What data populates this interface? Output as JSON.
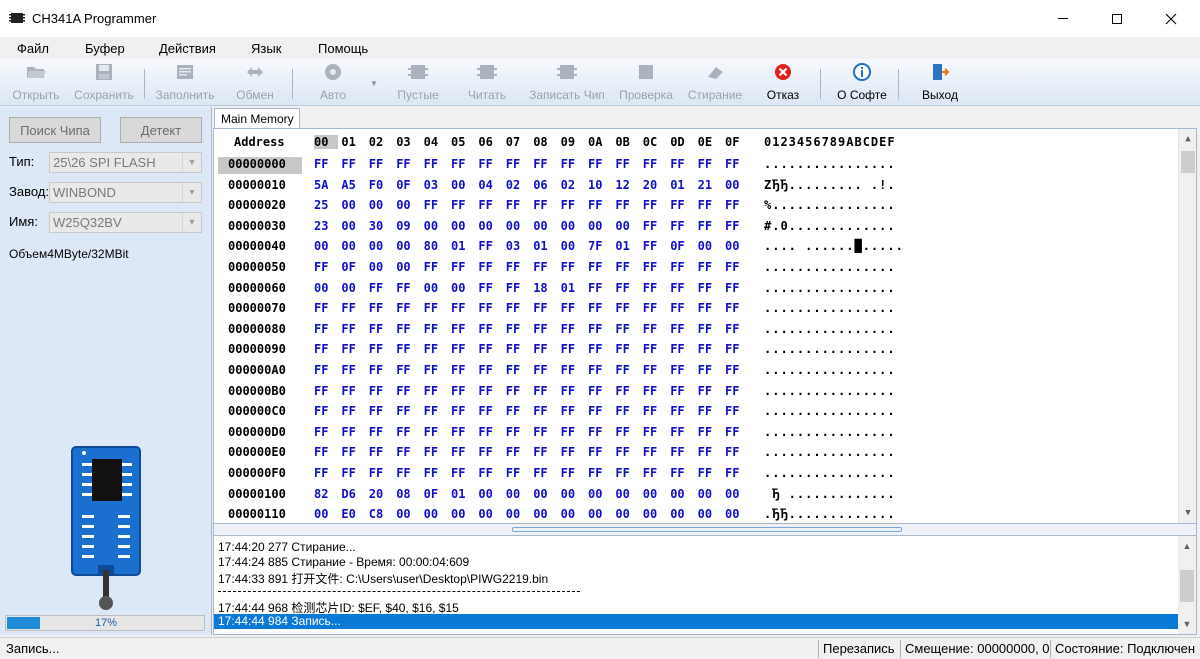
{
  "window": {
    "title": "CH341A Programmer"
  },
  "menu": [
    "Файл",
    "Буфер",
    "Действия",
    "Язык",
    "Помощь"
  ],
  "toolbar": {
    "buttons": [
      {
        "label": "Открыть",
        "icon": "folder-open-icon",
        "enabled": false
      },
      {
        "label": "Сохранить",
        "icon": "floppy-disk-icon",
        "enabled": false
      },
      {
        "label": "Заполнить",
        "icon": "fill-icon",
        "enabled": false
      },
      {
        "label": "Обмен",
        "icon": "swap-arrows-icon",
        "enabled": false
      },
      {
        "label": "Авто",
        "icon": "auto-gear-icon",
        "enabled": false
      },
      {
        "label": "Пустые",
        "icon": "chip-blank-icon",
        "enabled": false
      },
      {
        "label": "Читать",
        "icon": "chip-read-icon",
        "enabled": false
      },
      {
        "label": "Записать Чип",
        "icon": "chip-write-icon",
        "enabled": false
      },
      {
        "label": "Проверка",
        "icon": "chip-verify-icon",
        "enabled": false
      },
      {
        "label": "Стирание",
        "icon": "chip-erase-icon",
        "enabled": false
      },
      {
        "label": "Отказ",
        "icon": "cancel-red-icon",
        "enabled": true
      },
      {
        "label": "О Софте",
        "icon": "info-icon",
        "enabled": true
      },
      {
        "label": "Выход",
        "icon": "exit-door-icon",
        "enabled": true
      }
    ]
  },
  "left_panel": {
    "search_button": "Поиск Чипа",
    "detect_button": "Детект",
    "type_label": "Тип:",
    "type_value": "25\\26 SPI FLASH",
    "vendor_label": "Завод:",
    "vendor_value": "WINBOND",
    "name_label": "Имя:",
    "name_value": "W25Q32BV",
    "capacity": "Объем4MByte/32MBit",
    "progress_percent": 17,
    "progress_text": "17%"
  },
  "tab": {
    "label": "Main Memory"
  },
  "hex": {
    "address_header": "Address",
    "columns": [
      "00",
      "01",
      "02",
      "03",
      "04",
      "05",
      "06",
      "07",
      "08",
      "09",
      "0A",
      "0B",
      "0C",
      "0D",
      "0E",
      "0F"
    ],
    "ascii_header": "0123456789ABCDEF",
    "rows": [
      {
        "addr": "00000000",
        "bytes": [
          "FF",
          "FF",
          "FF",
          "FF",
          "FF",
          "FF",
          "FF",
          "FF",
          "FF",
          "FF",
          "FF",
          "FF",
          "FF",
          "FF",
          "FF",
          "FF"
        ],
        "ascii": "................"
      },
      {
        "addr": "00000010",
        "bytes": [
          "5A",
          "A5",
          "F0",
          "0F",
          "03",
          "00",
          "04",
          "02",
          "06",
          "02",
          "10",
          "12",
          "20",
          "01",
          "21",
          "00"
        ],
        "ascii": "ZЂЂ......... .!."
      },
      {
        "addr": "00000020",
        "bytes": [
          "25",
          "00",
          "00",
          "00",
          "FF",
          "FF",
          "FF",
          "FF",
          "FF",
          "FF",
          "FF",
          "FF",
          "FF",
          "FF",
          "FF",
          "FF"
        ],
        "ascii": "%..............."
      },
      {
        "addr": "00000030",
        "bytes": [
          "23",
          "00",
          "30",
          "09",
          "00",
          "00",
          "00",
          "00",
          "00",
          "00",
          "00",
          "00",
          "FF",
          "FF",
          "FF",
          "FF"
        ],
        "ascii": "#.0............."
      },
      {
        "addr": "00000040",
        "bytes": [
          "00",
          "00",
          "00",
          "00",
          "80",
          "01",
          "FF",
          "03",
          "01",
          "00",
          "7F",
          "01",
          "FF",
          "0F",
          "00",
          "00"
        ],
        "ascii": ".... ......█....."
      },
      {
        "addr": "00000050",
        "bytes": [
          "FF",
          "0F",
          "00",
          "00",
          "FF",
          "FF",
          "FF",
          "FF",
          "FF",
          "FF",
          "FF",
          "FF",
          "FF",
          "FF",
          "FF",
          "FF"
        ],
        "ascii": "................"
      },
      {
        "addr": "00000060",
        "bytes": [
          "00",
          "00",
          "FF",
          "FF",
          "00",
          "00",
          "FF",
          "FF",
          "18",
          "01",
          "FF",
          "FF",
          "FF",
          "FF",
          "FF",
          "FF"
        ],
        "ascii": "................"
      },
      {
        "addr": "00000070",
        "bytes": [
          "FF",
          "FF",
          "FF",
          "FF",
          "FF",
          "FF",
          "FF",
          "FF",
          "FF",
          "FF",
          "FF",
          "FF",
          "FF",
          "FF",
          "FF",
          "FF"
        ],
        "ascii": "................"
      },
      {
        "addr": "00000080",
        "bytes": [
          "FF",
          "FF",
          "FF",
          "FF",
          "FF",
          "FF",
          "FF",
          "FF",
          "FF",
          "FF",
          "FF",
          "FF",
          "FF",
          "FF",
          "FF",
          "FF"
        ],
        "ascii": "................"
      },
      {
        "addr": "00000090",
        "bytes": [
          "FF",
          "FF",
          "FF",
          "FF",
          "FF",
          "FF",
          "FF",
          "FF",
          "FF",
          "FF",
          "FF",
          "FF",
          "FF",
          "FF",
          "FF",
          "FF"
        ],
        "ascii": "................"
      },
      {
        "addr": "000000A0",
        "bytes": [
          "FF",
          "FF",
          "FF",
          "FF",
          "FF",
          "FF",
          "FF",
          "FF",
          "FF",
          "FF",
          "FF",
          "FF",
          "FF",
          "FF",
          "FF",
          "FF"
        ],
        "ascii": "................"
      },
      {
        "addr": "000000B0",
        "bytes": [
          "FF",
          "FF",
          "FF",
          "FF",
          "FF",
          "FF",
          "FF",
          "FF",
          "FF",
          "FF",
          "FF",
          "FF",
          "FF",
          "FF",
          "FF",
          "FF"
        ],
        "ascii": "................"
      },
      {
        "addr": "000000C0",
        "bytes": [
          "FF",
          "FF",
          "FF",
          "FF",
          "FF",
          "FF",
          "FF",
          "FF",
          "FF",
          "FF",
          "FF",
          "FF",
          "FF",
          "FF",
          "FF",
          "FF"
        ],
        "ascii": "................"
      },
      {
        "addr": "000000D0",
        "bytes": [
          "FF",
          "FF",
          "FF",
          "FF",
          "FF",
          "FF",
          "FF",
          "FF",
          "FF",
          "FF",
          "FF",
          "FF",
          "FF",
          "FF",
          "FF",
          "FF"
        ],
        "ascii": "................"
      },
      {
        "addr": "000000E0",
        "bytes": [
          "FF",
          "FF",
          "FF",
          "FF",
          "FF",
          "FF",
          "FF",
          "FF",
          "FF",
          "FF",
          "FF",
          "FF",
          "FF",
          "FF",
          "FF",
          "FF"
        ],
        "ascii": "................"
      },
      {
        "addr": "000000F0",
        "bytes": [
          "FF",
          "FF",
          "FF",
          "FF",
          "FF",
          "FF",
          "FF",
          "FF",
          "FF",
          "FF",
          "FF",
          "FF",
          "FF",
          "FF",
          "FF",
          "FF"
        ],
        "ascii": "................"
      },
      {
        "addr": "00000100",
        "bytes": [
          "82",
          "D6",
          "20",
          "08",
          "0F",
          "01",
          "00",
          "00",
          "00",
          "00",
          "00",
          "00",
          "00",
          "00",
          "00",
          "00"
        ],
        "ascii": " Ђ ............."
      },
      {
        "addr": "00000110",
        "bytes": [
          "00",
          "E0",
          "C8",
          "00",
          "00",
          "00",
          "00",
          "00",
          "00",
          "00",
          "00",
          "00",
          "00",
          "00",
          "00",
          "00"
        ],
        "ascii": ".ЂЂ............."
      }
    ]
  },
  "log": {
    "lines": [
      "17:44:20 277 Стирание...",
      "17:44:24 885 Стирание - Время: 00:00:04:609",
      "17:44:33 891 打开文件: C:\\Users\\user\\Desktop\\PIWG2219.bin",
      "17:44:44 968 检测芯片ID: $EF, $40, $16, $15",
      "17:44:44 984 Запись..."
    ]
  },
  "status": {
    "left": "Запись...",
    "mode": "Перезапись",
    "offset": "Смещение: 00000000, 0",
    "state": "Состояние: Подключен"
  },
  "colors": {
    "hex_byte": "#1010c8",
    "selection": "#0a78d7",
    "cancel_red": "#e02020",
    "info_blue": "#1a6fc9"
  }
}
